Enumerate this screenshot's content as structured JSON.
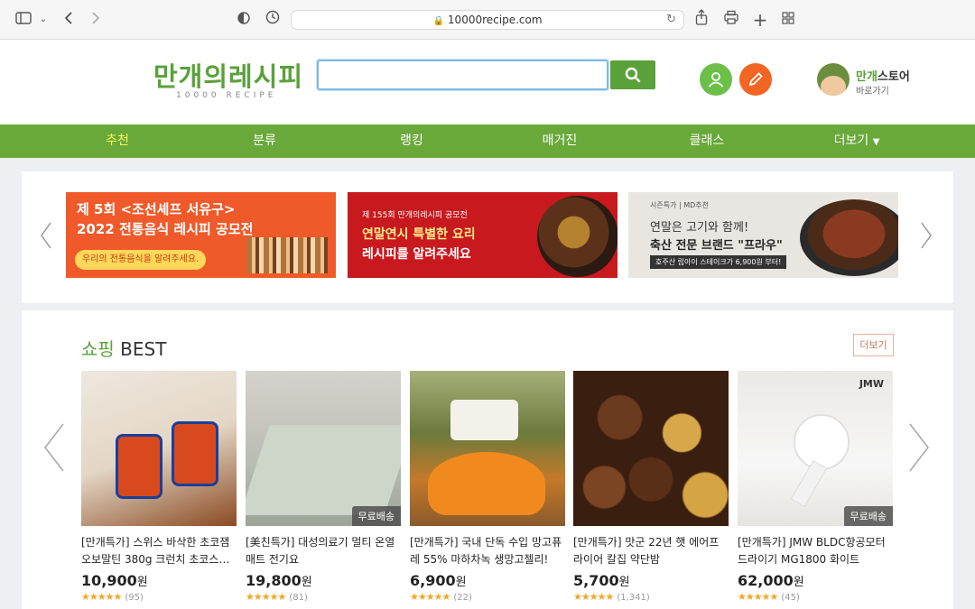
{
  "browser": {
    "url": "10000recipe.com",
    "icons": [
      "sidebar-icon",
      "chevron-down-icon",
      "back-icon",
      "forward-icon",
      "shield-icon",
      "history-icon",
      "lock-icon",
      "reload-icon",
      "share-icon",
      "print-icon",
      "new-tab-icon",
      "tab-overview-icon"
    ]
  },
  "header": {
    "logo_text": "만개의레시피",
    "logo_sub": "10000 RECIPE",
    "search_value": "",
    "store_name_green": "만개",
    "store_name_dark": "스토어",
    "store_link": "바로가기"
  },
  "nav": {
    "items": [
      "추천",
      "분류",
      "랭킹",
      "매거진",
      "클래스",
      "더보기"
    ]
  },
  "banners": [
    {
      "line1": "제 5회 <조선셰프 서유구>",
      "line2": "2022 전통음식 레시피 공모전",
      "pill": "우리의 전통음식을 알려주세요."
    },
    {
      "small": "제 155회 만개의레시피 공모전",
      "line1": "연말연시 특별한 요리",
      "line2": "레시피를 알려주세요"
    },
    {
      "small": "시즌특가 | MD추천",
      "line1": "연말은 고기와 함께!",
      "line2": "축산 전문 브랜드 \"프라우\"",
      "tag": "호주산 립아이 스테이크가 6,900원 부터!"
    }
  ],
  "shop": {
    "title_green": "쇼핑",
    "title_dark": " BEST",
    "more": "더보기",
    "free_label": "무료배송",
    "products": [
      {
        "name": "[만개특가] 스위스 바삭한 초코잼 오보말틴 380g 크런치 초코스…",
        "price": "10,900",
        "won": "원",
        "stars": "★★★★★",
        "reviews": "(95)"
      },
      {
        "name": "[美친특가] 대성의료기 멀티 온열매트 전기요",
        "price": "19,800",
        "won": "원",
        "stars": "★★★★★",
        "reviews": "(81)"
      },
      {
        "name": "[만개특가] 국내 단독 수입 망고퓨레 55% 마하차녹 생망고젤리!",
        "price": "6,900",
        "won": "원",
        "stars": "★★★★★",
        "reviews": "(22)"
      },
      {
        "name": "[만개특가] 맛군 22년 햇 에어프라이어 칼집 약단밤",
        "price": "5,700",
        "won": "원",
        "stars": "★★★★★",
        "reviews": "(1,341)"
      },
      {
        "name": "[만개특가] JMW BLDC항공모터 드라이기 MG1800 화이트",
        "price": "62,000",
        "won": "원",
        "stars": "★★★★★",
        "reviews": "(45)"
      }
    ],
    "brand_mark": "JMW"
  },
  "colors": {
    "brand_green": "#5aa13a",
    "nav_green": "#68a93a",
    "active_nav": "#fff65a",
    "edit_orange": "#f26522",
    "star": "#f5a623"
  }
}
